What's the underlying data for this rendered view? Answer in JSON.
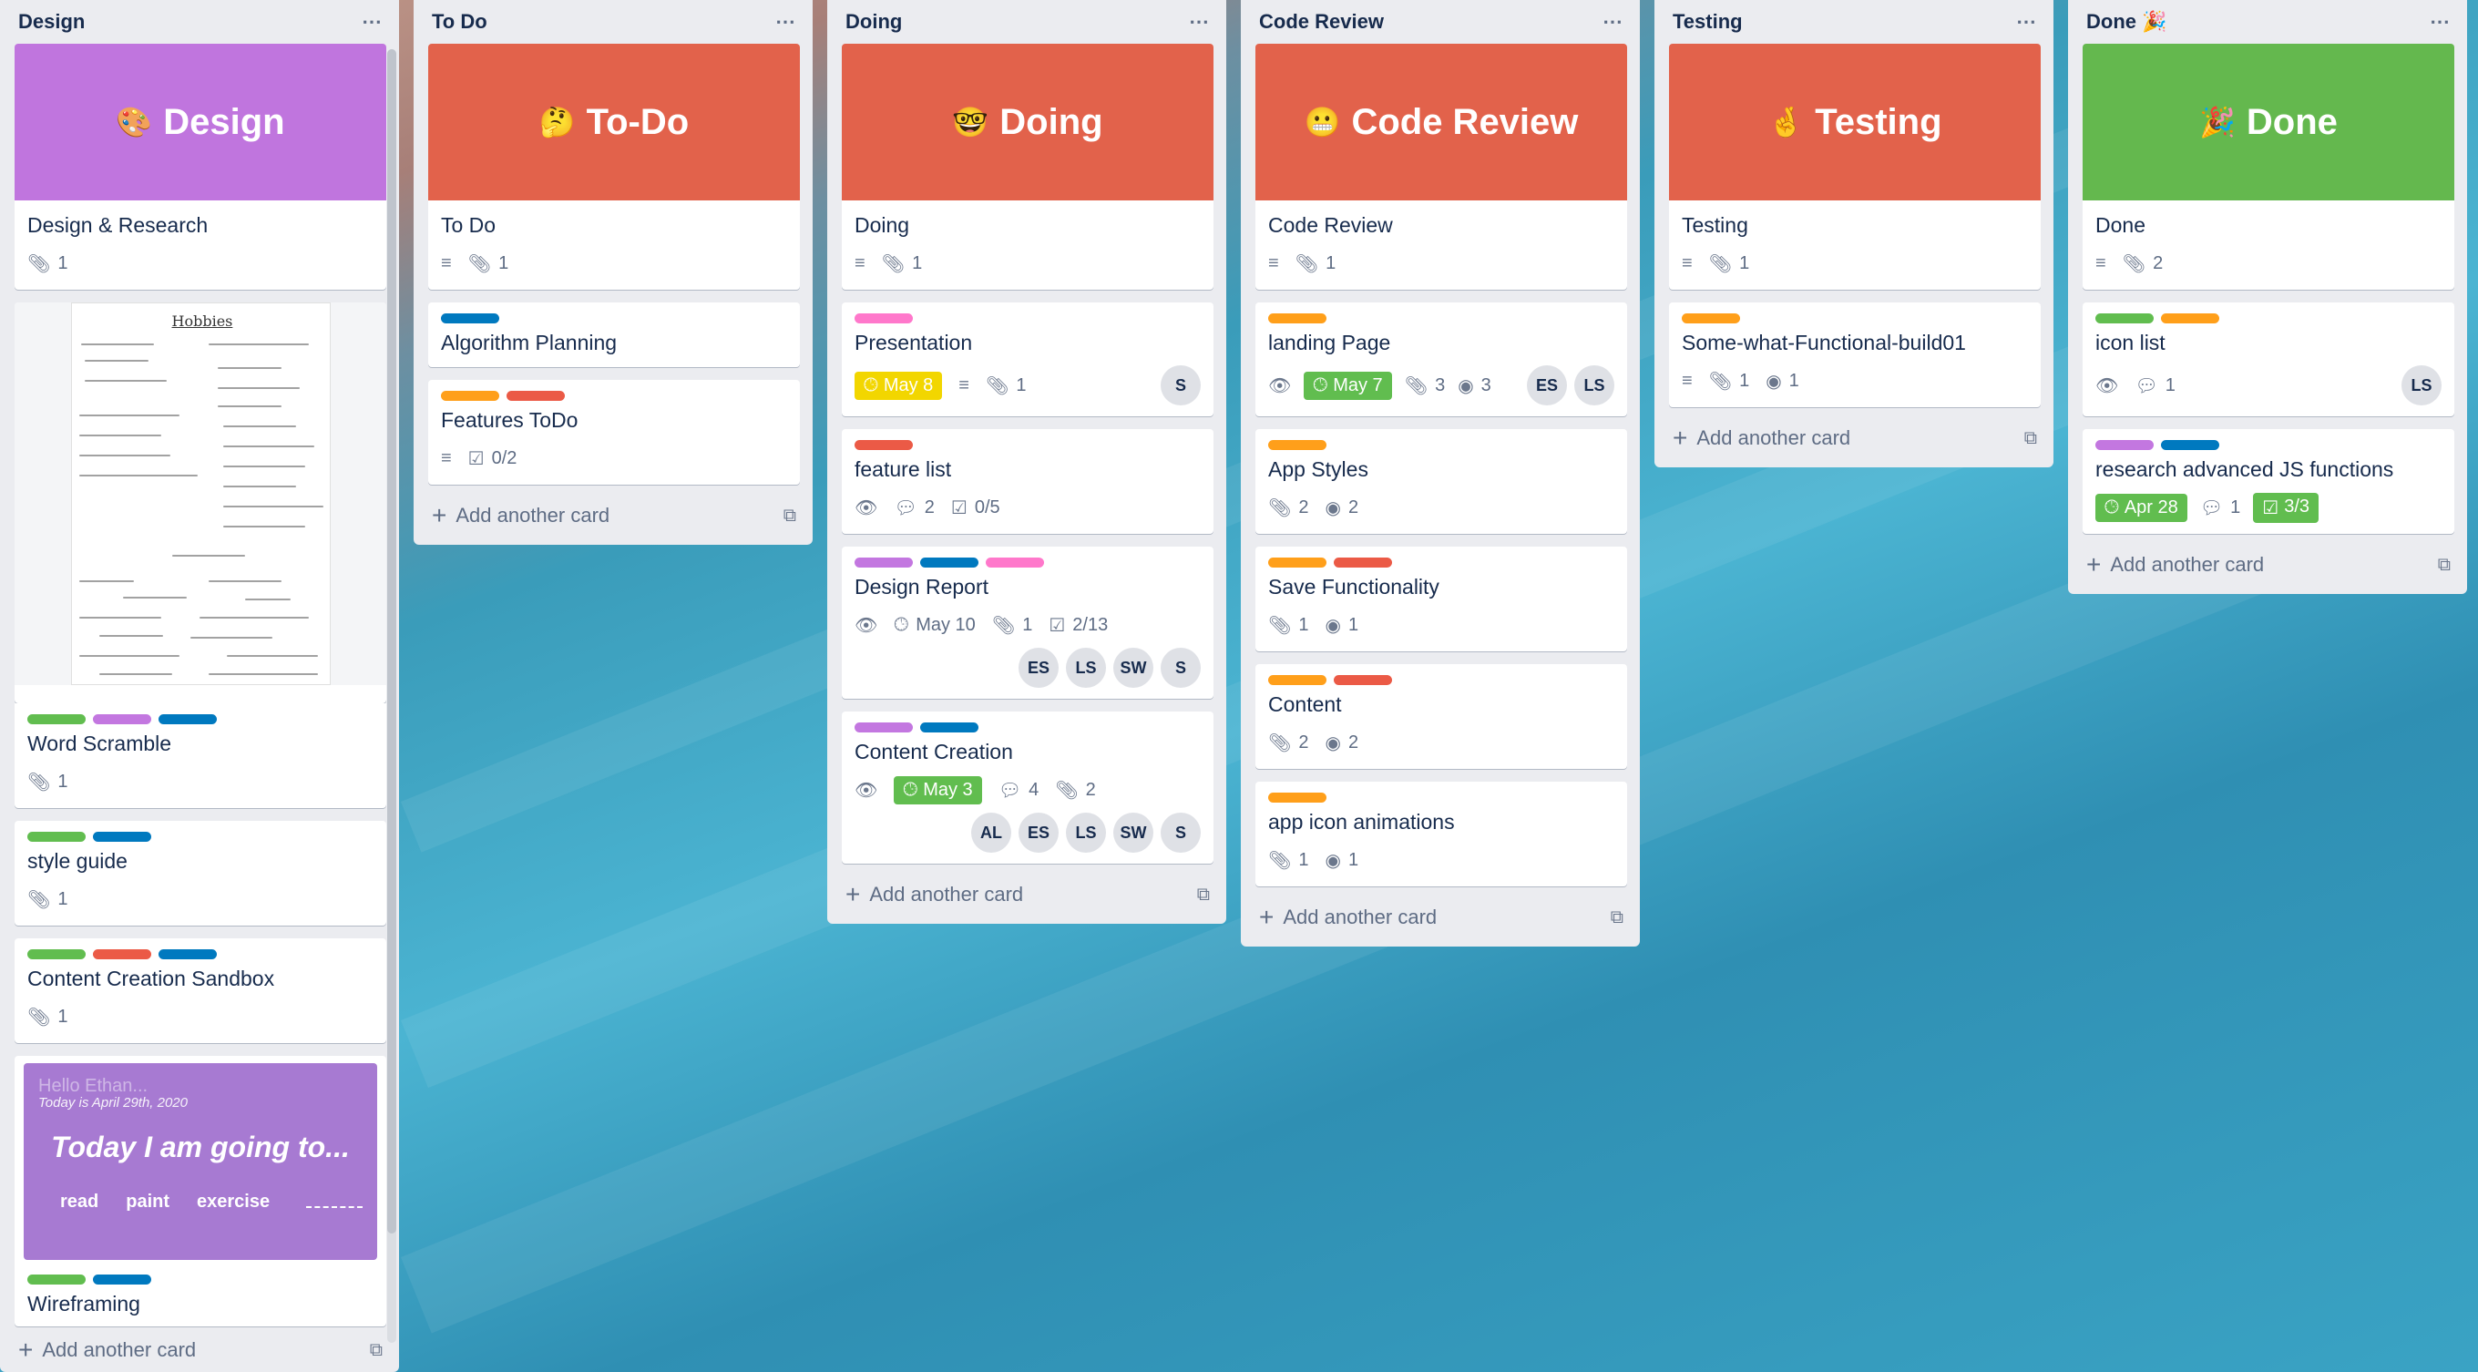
{
  "colors": {
    "green": "#61bd4f",
    "purple": "#c377e0",
    "blue": "#0079bf",
    "orange": "#ff9f1a",
    "red": "#eb5a46",
    "pink": "#ff78cb",
    "yellow": "#f2d600",
    "cover_purple": "#c075de",
    "cover_red": "#e2624b",
    "cover_green": "#64b84e"
  },
  "lists": [
    {
      "title": "Design",
      "cover": {
        "emoji": "🎨",
        "text": "Design",
        "color": "#c075de"
      },
      "first_card": {
        "title": "Design & Research",
        "attachments": "1"
      },
      "sketch_title": "Hobbies",
      "cards": [
        {
          "labels": [
            "#61bd4f",
            "#c377e0",
            "#0079bf"
          ],
          "title": "Word Scramble",
          "attachments": "1"
        },
        {
          "labels": [
            "#61bd4f",
            "#0079bf"
          ],
          "title": "style guide",
          "attachments": "1"
        },
        {
          "labels": [
            "#61bd4f",
            "#eb5a46",
            "#0079bf"
          ],
          "title": "Content Creation Sandbox",
          "attachments": "1"
        }
      ],
      "promo": {
        "greeting": "Hello Ethan...",
        "date": "Today is April 29th, 2020",
        "headline": "Today I am going to...",
        "actions": [
          "read",
          "paint",
          "exercise"
        ]
      },
      "last_card": {
        "labels": [
          "#61bd4f",
          "#0079bf"
        ],
        "title": "Wireframing"
      },
      "add_label": "Add another card"
    },
    {
      "title": "To Do",
      "cover": {
        "emoji": "🤔",
        "text": "To-Do",
        "color": "#e2624b"
      },
      "first_card": {
        "title": "To Do",
        "attachments": "1"
      },
      "cards": [
        {
          "labels": [
            "#0079bf"
          ],
          "title": "Algorithm Planning"
        },
        {
          "labels": [
            "#ff9f1a",
            "#eb5a46"
          ],
          "title": "Features ToDo",
          "checklist": "0/2"
        }
      ],
      "add_label": "Add another card"
    },
    {
      "title": "Doing",
      "cover": {
        "emoji": "🤓",
        "text": "Doing",
        "color": "#e2624b"
      },
      "first_card": {
        "title": "Doing",
        "attachments": "1"
      },
      "cards": [
        {
          "labels": [
            "#ff78cb"
          ],
          "title": "Presentation",
          "due": "May 8",
          "attachments": "1",
          "members": [
            "S"
          ]
        },
        {
          "labels": [
            "#eb5a46"
          ],
          "title": "feature list",
          "comments": "2",
          "checklist": "0/5"
        },
        {
          "labels": [
            "#c377e0",
            "#0079bf",
            "#ff78cb"
          ],
          "title": "Design Report",
          "due": "May 10",
          "attachments": "1",
          "checklist": "2/13",
          "members": [
            "ES",
            "LS",
            "SW",
            "S"
          ]
        },
        {
          "labels": [
            "#c377e0",
            "#0079bf"
          ],
          "title": "Content Creation",
          "due": "May 3",
          "comments": "4",
          "attachments": "2",
          "members": [
            "AL",
            "ES",
            "LS",
            "SW",
            "S"
          ]
        }
      ],
      "add_label": "Add another card"
    },
    {
      "title": "Code Review",
      "cover": {
        "emoji": "😬",
        "text": "Code Review",
        "color": "#e2624b"
      },
      "first_card": {
        "title": "Code Review",
        "attachments": "1"
      },
      "cards": [
        {
          "labels": [
            "#ff9f1a"
          ],
          "title": "landing Page",
          "due": "May 7",
          "attachments": "3",
          "github": "3",
          "members": [
            "ES",
            "LS"
          ]
        },
        {
          "labels": [
            "#ff9f1a"
          ],
          "title": "App Styles",
          "attachments": "2",
          "github": "2"
        },
        {
          "labels": [
            "#ff9f1a",
            "#eb5a46"
          ],
          "title": "Save Functionality",
          "attachments": "1",
          "github": "1"
        },
        {
          "labels": [
            "#ff9f1a",
            "#eb5a46"
          ],
          "title": "Content",
          "attachments": "2",
          "github": "2"
        },
        {
          "labels": [
            "#ff9f1a"
          ],
          "title": "app icon animations",
          "attachments": "1",
          "github": "1"
        }
      ],
      "add_label": "Add another card"
    },
    {
      "title": "Testing",
      "cover": {
        "emoji": "🤞",
        "text": "Testing",
        "color": "#e2624b"
      },
      "first_card": {
        "title": "Testing",
        "attachments": "1"
      },
      "cards": [
        {
          "labels": [
            "#ff9f1a"
          ],
          "title": "Some-what-Functional-build01",
          "attachments": "1",
          "github": "1"
        }
      ],
      "add_label": "Add another card"
    },
    {
      "title": "Done 🎉",
      "cover": {
        "emoji": "🎉",
        "text": "Done",
        "color": "#64b84e"
      },
      "first_card": {
        "title": "Done",
        "attachments": "2"
      },
      "cards": [
        {
          "labels": [
            "#61bd4f",
            "#ff9f1a"
          ],
          "title": "icon list",
          "comments": "1",
          "members": [
            "LS"
          ]
        },
        {
          "labels": [
            "#c377e0",
            "#0079bf"
          ],
          "title": "research advanced JS functions",
          "due": "Apr 28",
          "comments": "1",
          "checklist": "3/3"
        }
      ],
      "add_label": "Add another card"
    }
  ],
  "icons": {
    "menu": "more-horizontal-icon",
    "description": "description-icon",
    "attachment": "paperclip-icon",
    "watch": "eye-icon",
    "clock": "clock-icon",
    "comment": "comment-icon",
    "checklist": "checkbox-icon",
    "github": "github-icon",
    "plus": "plus-icon",
    "template": "card-template-icon"
  }
}
